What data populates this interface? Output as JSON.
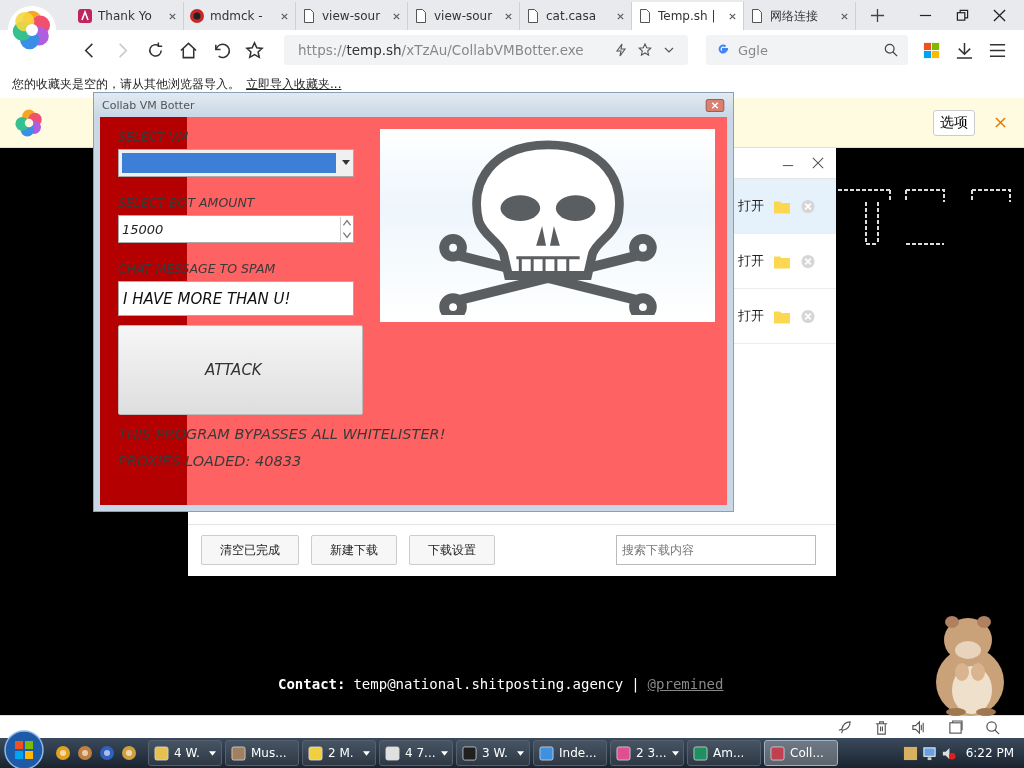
{
  "browser": {
    "tabs": [
      {
        "title": "Thank Yo",
        "kind": "app",
        "selected": false
      },
      {
        "title": "mdmck -",
        "kind": "avatar",
        "selected": false
      },
      {
        "title": "view-sour",
        "kind": "page",
        "selected": false
      },
      {
        "title": "view-sour",
        "kind": "page",
        "selected": false
      },
      {
        "title": "cat.casa",
        "kind": "page",
        "selected": false
      },
      {
        "title": "Temp.sh |",
        "kind": "page",
        "selected": true
      },
      {
        "title": "网络连接",
        "kind": "page",
        "selected": false
      }
    ],
    "nav_buttons": [
      {
        "kind": "back",
        "disabled": false
      },
      {
        "kind": "forward",
        "disabled": true
      },
      {
        "kind": "reload",
        "disabled": false
      },
      {
        "kind": "home",
        "disabled": false
      },
      {
        "kind": "undo",
        "disabled": false
      },
      {
        "kind": "bookmark",
        "disabled": false
      }
    ],
    "address": {
      "value": "https://**temp.sh**/xTzAu/CollabVMBotter.exe"
    },
    "search": {
      "placeholder": "Ggle"
    },
    "bookmarks_bar": {
      "message": "您的收藏夹是空的，请从其他浏览器导入。",
      "link": "立即导入收藏夹..."
    },
    "translate_bar": {
      "options_button": "选项"
    }
  },
  "downloads_panel": {
    "items": [
      {
        "action": "打开",
        "selected": true
      },
      {
        "action": "打开",
        "selected": false
      },
      {
        "action": "打开",
        "selected": false
      }
    ],
    "buttons": [
      "清空已完成",
      "新建下载",
      "下载设置"
    ],
    "search": {
      "placeholder": "搜索下载内容"
    }
  },
  "bot_window": {
    "title": "Collab VM Botter",
    "vm_label": "SELECT VM",
    "amount_label": "SELECT BOT AMOUNT",
    "amount_value": "15000",
    "chat_label": "CHAT MESSAGE TO SPAM",
    "chat_value": "I HAVE MORE THAN U!",
    "attack_button": "ATTACK",
    "notices": [
      "THIS PROGRAM BYPASSES ALL WHITELISTER!",
      "PROXIES LOADED: 40833"
    ]
  },
  "page": {
    "contact_label": "Contact:",
    "contact_email": "temp@national.shitposting.agency",
    "separator": "|",
    "contact_link": "@premined"
  },
  "taskbar": {
    "tasks": [
      {
        "label": "4 W.",
        "group": true,
        "selected": false
      },
      {
        "label": "Mus...",
        "group": false,
        "selected": false
      },
      {
        "label": "2 M.",
        "group": true,
        "selected": false
      },
      {
        "label": "4 7...",
        "group": true,
        "selected": false
      },
      {
        "label": "3 W.",
        "group": true,
        "selected": false
      },
      {
        "label": "Inde...",
        "group": false,
        "selected": false
      },
      {
        "label": "2 3...",
        "group": true,
        "selected": false
      },
      {
        "label": "Am...",
        "group": false,
        "selected": false
      },
      {
        "label": "Coll...",
        "group": false,
        "selected": true
      }
    ],
    "clock": "6:22 PM"
  }
}
